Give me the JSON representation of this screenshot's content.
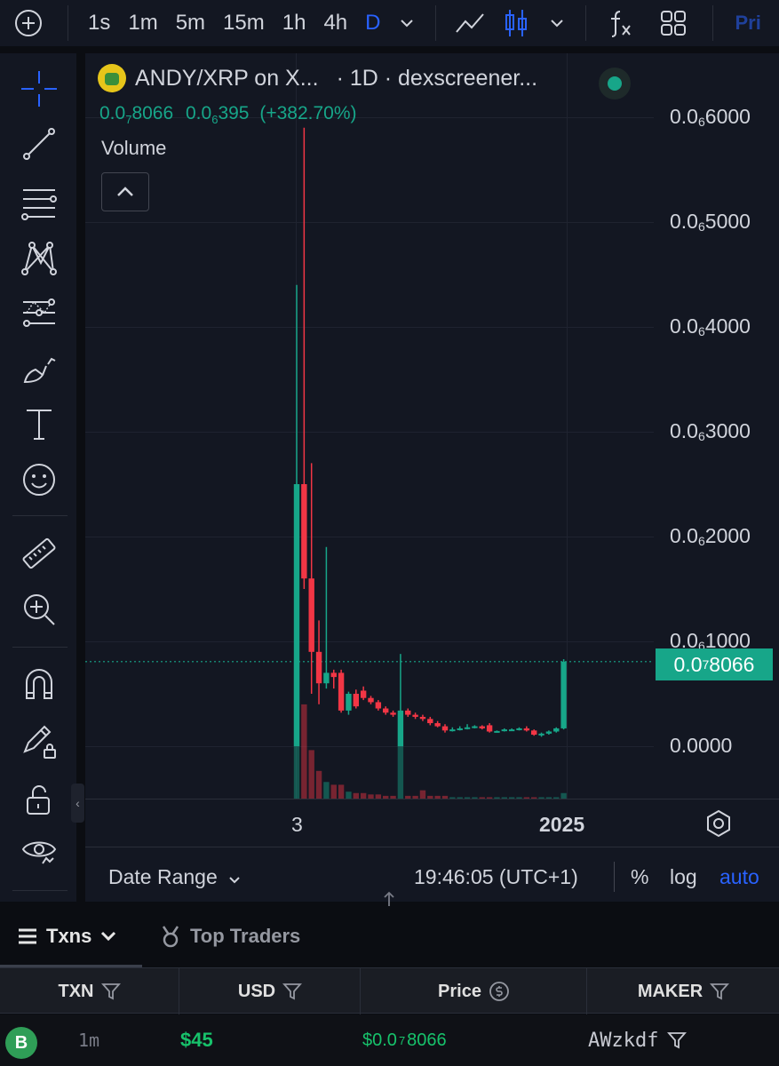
{
  "toolbar": {
    "intervals": [
      "1s",
      "1m",
      "5m",
      "15m",
      "1h",
      "4h",
      "D"
    ],
    "active_interval": "D",
    "icons": [
      "add-circle-icon",
      "chevron-down-icon",
      "line-chart-icon",
      "candles-icon",
      "indicators-fx-icon",
      "layouts-grid-icon"
    ],
    "price_tab": "Pri"
  },
  "left_tools": [
    "crosshair-icon",
    "trendline-icon",
    "fib-lines-icon",
    "pattern-icon",
    "projection-icon",
    "brush-icon",
    "text-icon",
    "emoji-icon",
    "ruler-icon",
    "zoom-in-icon",
    "magnet-icon",
    "lock-draw-icon",
    "unlock-icon",
    "eye-icon"
  ],
  "chart": {
    "symbol": "ANDY/XRP on X...",
    "meta": "· 1D · dexscreener...",
    "ohlc_a_main": "0.0",
    "ohlc_a_sub": "7",
    "ohlc_a_tail": "8066",
    "ohlc_b_main": "0.0",
    "ohlc_b_sub": "6",
    "ohlc_b_tail": "395",
    "ohlc_change": "(+382.70%)",
    "volume_label": "Volume",
    "price_tag_main": "0.0",
    "price_tag_sub": "7",
    "price_tag_tail": "8066",
    "x_labels": [
      "3",
      "2025"
    ],
    "bottom": {
      "date_range": "Date Range",
      "clock": "19:46:05 (UTC+1)",
      "pct": "%",
      "log": "log",
      "auto": "auto"
    }
  },
  "chart_data": {
    "type": "candlestick",
    "y_ticks": [
      {
        "main": "0.0",
        "sub": "6",
        "tail": "6000",
        "value": 6e-07
      },
      {
        "main": "0.0",
        "sub": "6",
        "tail": "5000",
        "value": 5e-07
      },
      {
        "main": "0.0",
        "sub": "6",
        "tail": "4000",
        "value": 4e-07
      },
      {
        "main": "0.0",
        "sub": "6",
        "tail": "3000",
        "value": 3e-07
      },
      {
        "main": "0.0",
        "sub": "6",
        "tail": "2000",
        "value": 2e-07
      },
      {
        "main": "0.0",
        "sub": "6",
        "tail": "1000",
        "value": 1e-07
      },
      {
        "main": "0.0000",
        "sub": "",
        "tail": "",
        "value": 0
      }
    ],
    "ylim": [
      0,
      6e-07
    ],
    "last_price": 8.066e-08,
    "candles": [
      {
        "o": 0.0,
        "h": 4.4e-07,
        "l": 0.0,
        "c": 2.5e-07,
        "v": 1.0
      },
      {
        "o": 2.5e-07,
        "h": 5.9e-07,
        "l": 1.5e-07,
        "c": 1.6e-07,
        "v": 0.68
      },
      {
        "o": 1.6e-07,
        "h": 2.7e-07,
        "l": 5e-08,
        "c": 9e-08,
        "v": 0.35
      },
      {
        "o": 9e-08,
        "h": 1.2e-07,
        "l": 4e-08,
        "c": 6e-08,
        "v": 0.2
      },
      {
        "o": 6e-08,
        "h": 1.9e-07,
        "l": 5.5e-08,
        "c": 7e-08,
        "v": 0.12
      },
      {
        "o": 7e-08,
        "h": 7.3e-08,
        "l": 5.5e-08,
        "c": 6.6e-08,
        "v": 0.1
      },
      {
        "o": 7e-08,
        "h": 7.3e-08,
        "l": 3.2e-08,
        "c": 3.4e-08,
        "v": 0.1
      },
      {
        "o": 3.4e-08,
        "h": 5.2e-08,
        "l": 3e-08,
        "c": 5e-08,
        "v": 0.05
      },
      {
        "o": 5e-08,
        "h": 5.4e-08,
        "l": 3.6e-08,
        "c": 3.8e-08,
        "v": 0.04
      },
      {
        "o": 5.3e-08,
        "h": 5.7e-08,
        "l": 4.4e-08,
        "c": 4.6e-08,
        "v": 0.04
      },
      {
        "o": 4.6e-08,
        "h": 4.8e-08,
        "l": 4e-08,
        "c": 4.2e-08,
        "v": 0.03
      },
      {
        "o": 4.2e-08,
        "h": 4.4e-08,
        "l": 3.4e-08,
        "c": 3.6e-08,
        "v": 0.03
      },
      {
        "o": 3.6e-08,
        "h": 3.8e-08,
        "l": 3e-08,
        "c": 3.2e-08,
        "v": 0.02
      },
      {
        "o": 3.2e-08,
        "h": 3.4e-08,
        "l": 2.8e-08,
        "c": 3e-08,
        "v": 0.02
      },
      {
        "o": 0.0,
        "h": 8.8e-08,
        "l": 0.0,
        "c": 3.4e-08,
        "v": 0.38
      },
      {
        "o": 3.4e-08,
        "h": 3.6e-08,
        "l": 2.8e-08,
        "c": 3e-08,
        "v": 0.02
      },
      {
        "o": 3e-08,
        "h": 3.2e-08,
        "l": 2.6e-08,
        "c": 2.8e-08,
        "v": 0.02
      },
      {
        "o": 2.8e-08,
        "h": 3e-08,
        "l": 2.4e-08,
        "c": 2.6e-08,
        "v": 0.06
      },
      {
        "o": 2.6e-08,
        "h": 2.8e-08,
        "l": 2e-08,
        "c": 2.2e-08,
        "v": 0.02
      },
      {
        "o": 2.2e-08,
        "h": 2.4e-08,
        "l": 1.8e-08,
        "c": 1.9e-08,
        "v": 0.02
      },
      {
        "o": 1.9e-08,
        "h": 2.1e-08,
        "l": 1.3e-08,
        "c": 1.5e-08,
        "v": 0.02
      },
      {
        "o": 1.5e-08,
        "h": 1.8e-08,
        "l": 1.4e-08,
        "c": 1.6e-08,
        "v": 0.01
      },
      {
        "o": 1.6e-08,
        "h": 1.9e-08,
        "l": 1.5e-08,
        "c": 1.7e-08,
        "v": 0.01
      },
      {
        "o": 1.7e-08,
        "h": 2.1e-08,
        "l": 1.6e-08,
        "c": 1.8e-08,
        "v": 0.01
      },
      {
        "o": 1.8e-08,
        "h": 2e-08,
        "l": 1.7e-08,
        "c": 1.9e-08,
        "v": 0.01
      },
      {
        "o": 1.9e-08,
        "h": 2e-08,
        "l": 1.6e-08,
        "c": 1.7e-08,
        "v": 0.01
      },
      {
        "o": 2e-08,
        "h": 2.2e-08,
        "l": 1.3e-08,
        "c": 1.4e-08,
        "v": 0.01
      },
      {
        "o": 1.4e-08,
        "h": 1.5e-08,
        "l": 1.3e-08,
        "c": 1.45e-08,
        "v": 0.01
      },
      {
        "o": 1.45e-08,
        "h": 1.7e-08,
        "l": 1.4e-08,
        "c": 1.6e-08,
        "v": 0.01
      },
      {
        "o": 1.6e-08,
        "h": 1.7e-08,
        "l": 1.5e-08,
        "c": 1.6e-08,
        "v": 0.01
      },
      {
        "o": 1.6e-08,
        "h": 1.8e-08,
        "l": 1.5e-08,
        "c": 1.7e-08,
        "v": 0.01
      },
      {
        "o": 1.7e-08,
        "h": 1.9e-08,
        "l": 1.4e-08,
        "c": 1.5e-08,
        "v": 0.01
      },
      {
        "o": 1.5e-08,
        "h": 1.6e-08,
        "l": 1e-08,
        "c": 1.1e-08,
        "v": 0.01
      },
      {
        "o": 1.1e-08,
        "h": 1.3e-08,
        "l": 9e-09,
        "c": 1.2e-08,
        "v": 0.01
      },
      {
        "o": 1.2e-08,
        "h": 1.5e-08,
        "l": 1.1e-08,
        "c": 1.4e-08,
        "v": 0.01
      },
      {
        "o": 1.4e-08,
        "h": 1.8e-08,
        "l": 1.3e-08,
        "c": 1.7e-08,
        "v": 0.01
      },
      {
        "o": 1.7e-08,
        "h": 8.3e-08,
        "l": 1.6e-08,
        "c": 8.066e-08,
        "v": 0.04
      }
    ]
  },
  "tabs": {
    "txns": "Txns",
    "top_traders": "Top Traders"
  },
  "table": {
    "headers": [
      "TXN",
      "USD",
      "Price",
      "MAKER"
    ],
    "rows": [
      {
        "type": "B",
        "age": "1m",
        "usd": "$45",
        "price_main": "$0.0",
        "price_sub": "7",
        "price_tail": "8066",
        "maker": "AWzkdf"
      }
    ]
  },
  "colors": {
    "up": "#17a689",
    "down": "#f23645",
    "accent": "#2962ff",
    "buy": "#17c26b"
  }
}
